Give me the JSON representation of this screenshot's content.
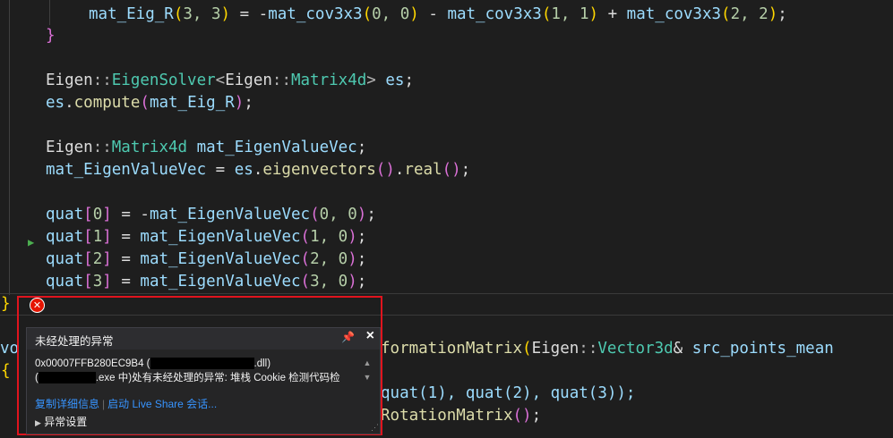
{
  "code": {
    "line_assign_prefix": "mat_Eig_R",
    "line_assign_args": "3, 3",
    "line_assign_rhs_fn": "mat_cov3x3",
    "line_assign_rhs_a1": "0, 0",
    "line_assign_rhs_a2": "1, 1",
    "line_assign_rhs_a3": "2, 2",
    "ns": "Eigen",
    "solver_type": "EigenSolver",
    "matrix4d": "Matrix4d",
    "es": "es",
    "compute": "compute",
    "mat_eig_r": "mat_Eig_R",
    "eigvec_var": "mat_EigenValueVec",
    "eigenvectors": "eigenvectors",
    "real": "real",
    "quat": "quat",
    "idx0": "0",
    "idx1": "1",
    "idx2": "2",
    "idx3": "3",
    "arg0": "0, 0",
    "arg1": "1, 0",
    "arg2": "2, 0",
    "arg3": "3, 0",
    "frag_vo": "vo",
    "frag_sig_fn": "formationMatrix",
    "frag_vector3d": "Vector3d",
    "frag_param": "src_points_mean",
    "frag_quat_args": "quat(1), quat(2), quat(3));",
    "frag_rot": "RotationMatrix"
  },
  "exception": {
    "title": "未经处理的异常",
    "address": "0x00007FFB280EC9B4 (",
    "dll_suffix": ".dll)",
    "exe_prefix": "(",
    "exe_suffix": ".exe 中)处有未经处理的异常: 堆栈 Cookie 检测代码检",
    "link_copy": "复制详细信息",
    "link_live_share": "启动 Live Share 会话...",
    "settings": "异常设置",
    "icons": [
      "error-icon",
      "pin-icon",
      "close-icon"
    ]
  },
  "colors": {
    "background": "#1e1e1e",
    "error": "#e51400",
    "link": "#3794ff",
    "type": "#4ec9b0",
    "function": "#dcdcaa",
    "variable": "#9cdcfe",
    "number": "#b5cea8"
  }
}
